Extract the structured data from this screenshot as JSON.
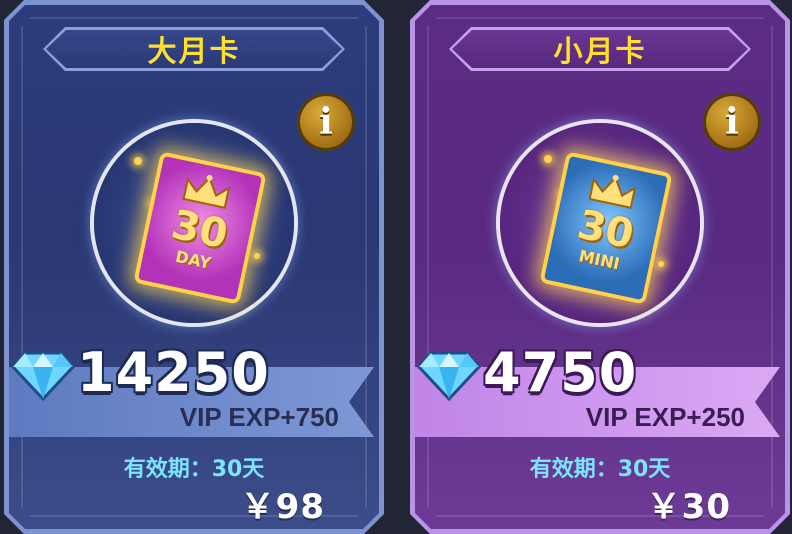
{
  "cards": [
    {
      "title": "大月卡",
      "card_number": "30",
      "card_label": "DAY",
      "diamonds": "14250",
      "vip_exp": "VIP EXP+750",
      "validity": "有效期：30天",
      "price": "￥98",
      "info_label": "i"
    },
    {
      "title": "小月卡",
      "card_number": "30",
      "card_label": "MINI",
      "diamonds": "4750",
      "vip_exp": "VIP EXP+250",
      "validity": "有效期：30天",
      "price": "￥30",
      "info_label": "i"
    }
  ],
  "colors": {
    "title_yellow": "#ffe12d",
    "validity_cyan": "#7be4ff",
    "blue_frame": "#7c93cf",
    "purple_frame": "#b993e6"
  }
}
